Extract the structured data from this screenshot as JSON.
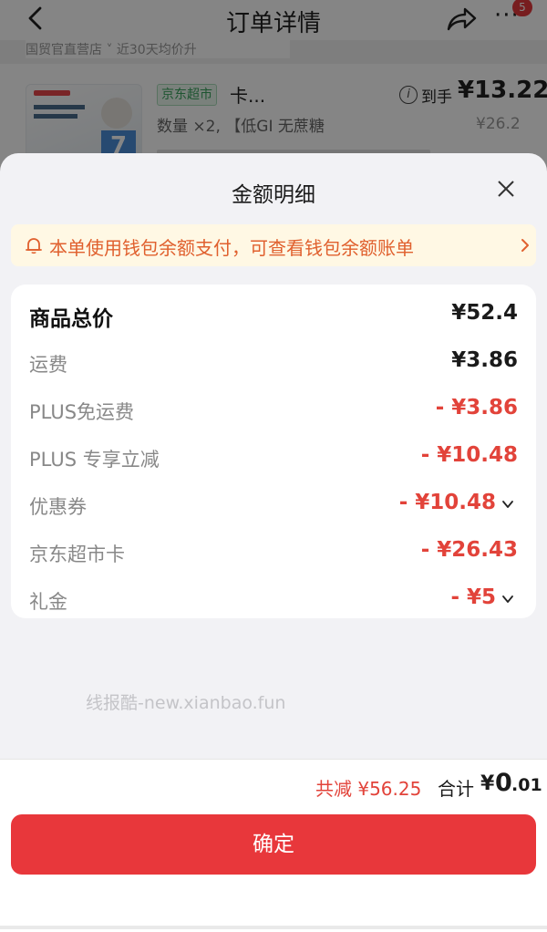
{
  "background": {
    "title": "订单详情",
    "badge_count": "5",
    "more_label": "···",
    "tag_strip_text": "国贸官直营店 ˅ 近30天均价升",
    "product": {
      "store_tag": "京东超市",
      "name": "卡...",
      "price_label": "到手",
      "price": "¥13.22",
      "quantity_text": "数量 ×2, 【低GI 无蔗糖",
      "original_price": "¥26.2"
    },
    "thumb_number": "7"
  },
  "sheet": {
    "title": "金额明细",
    "notice": "本单使用钱包余额支付，可查看钱包余额账单",
    "rows": [
      {
        "label": "商品总价",
        "value": "¥52.4"
      },
      {
        "label": "运费",
        "value": "¥3.86"
      },
      {
        "label": "PLUS免运费",
        "value": "- ¥3.86"
      },
      {
        "label": "PLUS 专享立减",
        "value": "- ¥10.48"
      },
      {
        "label": "优惠券",
        "value": "- ¥10.48"
      },
      {
        "label": "京东超市卡",
        "value": "- ¥26.43"
      },
      {
        "label": "礼金",
        "value": "- ¥5"
      }
    ],
    "watermark": "线报酷-new.xianbao.fun"
  },
  "footer": {
    "discount_text": "共减 ¥56.25",
    "total_label": "合计",
    "total_currency": "¥",
    "total_int": "0",
    "total_dec": ".01",
    "confirm_label": "确定"
  },
  "colors": {
    "accent_red": "#e8373b",
    "discount_red": "#e2433a",
    "notice_bg": "#fff8e4",
    "notice_text": "#e0602e"
  }
}
